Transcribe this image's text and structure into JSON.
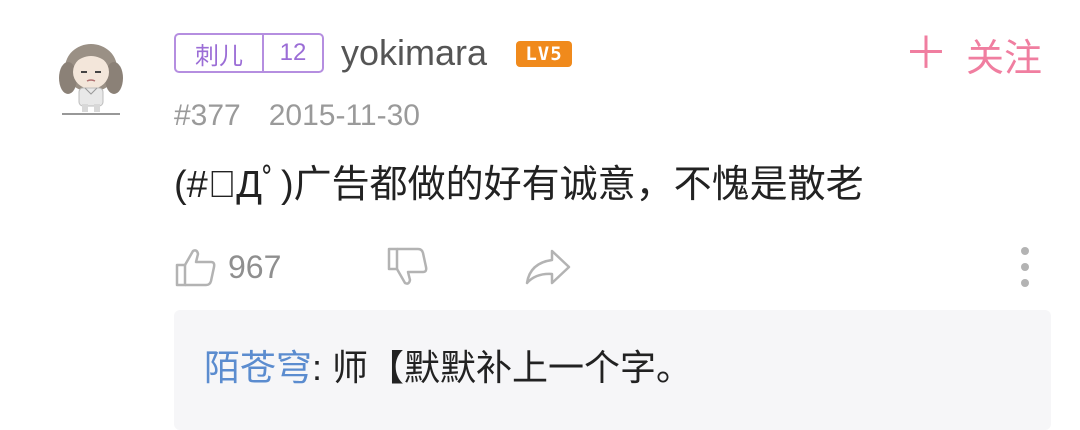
{
  "comment": {
    "avatar_icon": "girl-avatar-icon",
    "badge": {
      "name": "刺儿",
      "level": "12"
    },
    "username": "yokimara",
    "user_level": "LV5",
    "follow": {
      "icon": "plus-icon",
      "label": "关注"
    },
    "floor": "#377",
    "date": "2015-11-30",
    "text": "(#ﾟДﾟ)广告都做的好有诚意，不愧是散老",
    "actions": {
      "like_icon": "thumbs-up-icon",
      "like_count": "967",
      "dislike_icon": "thumbs-down-icon",
      "share_icon": "share-arrow-icon",
      "more_icon": "vertical-dots-icon"
    }
  },
  "reply": {
    "user": "陌苍穹",
    "separator": ": ",
    "text": "师【默默补上一个字。"
  },
  "colors": {
    "badge_purple": "#b58ee0",
    "level_orange": "#f08a1c",
    "follow_pink": "#f07ea0",
    "reply_user_blue": "#5b8ccf",
    "reply_background": "#f6f6f8"
  }
}
